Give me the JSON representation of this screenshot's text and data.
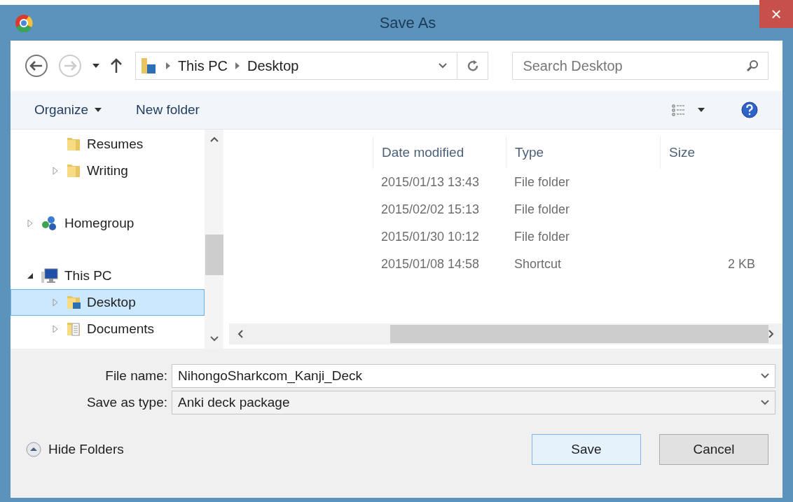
{
  "window": {
    "title": "Save As",
    "close": "×"
  },
  "address_bar": {
    "path": [
      "This PC",
      "Desktop"
    ]
  },
  "search": {
    "placeholder": "Search Desktop"
  },
  "toolbar": {
    "organize": "Organize",
    "new_folder": "New folder"
  },
  "nav_tree": [
    {
      "children": [
        {
          "label": "Resumes",
          "kind": "folder",
          "selected": false
        },
        {
          "label": "Writing",
          "kind": "folder",
          "expanded": false,
          "selected": false
        }
      ]
    },
    {
      "label": "Homegroup",
      "kind": "homegroup",
      "expanded": false,
      "selected": false
    },
    {
      "label": "This PC",
      "kind": "computer",
      "expanded": true,
      "selected": false,
      "children": [
        {
          "label": "Desktop",
          "kind": "desktop",
          "expanded": false,
          "selected": true
        },
        {
          "label": "Documents",
          "kind": "documents",
          "expanded": false,
          "selected": false
        }
      ]
    }
  ],
  "file_list": {
    "columns": [
      "Date modified",
      "Type",
      "Size"
    ],
    "rows": [
      {
        "date": "2015/01/13 13:43",
        "type": "File folder"
      },
      {
        "date": "2015/02/02 15:13",
        "type": "File folder"
      },
      {
        "date": "2015/01/30 10:12",
        "type": "File folder"
      },
      {
        "date": "2015/01/08 14:58",
        "type": "Shortcut",
        "size": "2 KB"
      }
    ]
  },
  "file_name": {
    "label": "File name:",
    "value": "NihongoSharkcom_Kanji_Deck"
  },
  "save_type": {
    "label": "Save as type:",
    "value": "Anki deck package"
  },
  "hide_folders": "Hide Folders",
  "buttons": {
    "save": "Save",
    "cancel": "Cancel"
  }
}
